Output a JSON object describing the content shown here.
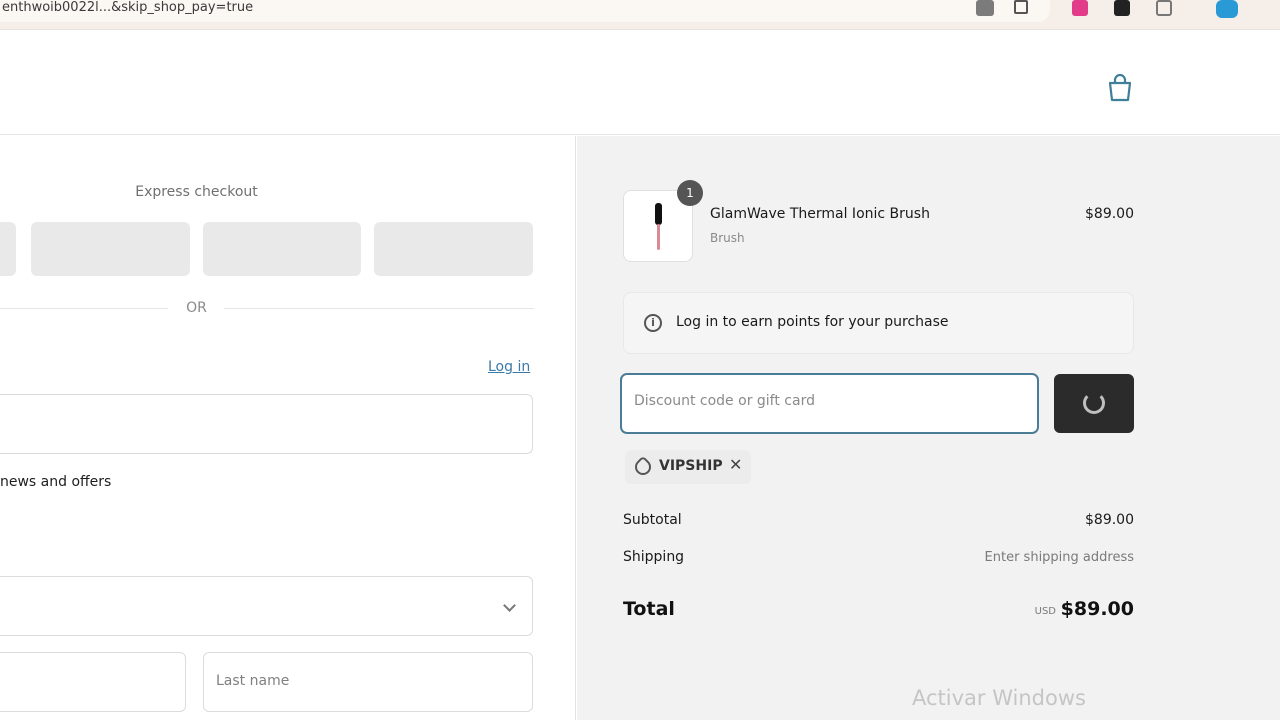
{
  "browser": {
    "url_text": "enthwoib0022l...&skip_shop_pay=true"
  },
  "express": {
    "title": "Express checkout",
    "or_label": "OR"
  },
  "contact": {
    "login_link": "Log in",
    "news_label": "news and offers"
  },
  "delivery": {
    "last_name_placeholder": "Last name"
  },
  "cart": {
    "item": {
      "name": "GlamWave Thermal Ionic Brush",
      "variant": "Brush",
      "price": "$89.00",
      "quantity": "1"
    },
    "earn_points_text": "Log in to earn points for your purchase",
    "discount_placeholder": "Discount code or gift card",
    "applied_code": "VIPSHIP",
    "subtotal_label": "Subtotal",
    "subtotal_value": "$89.00",
    "shipping_label": "Shipping",
    "shipping_value": "Enter shipping address",
    "total_label": "Total",
    "currency": "USD",
    "total_value": "$89.00"
  },
  "os_watermark": "Activar Windows",
  "colors": {
    "accent_link": "#3b7aa8",
    "focus_border": "#4a7d95",
    "apply_button": "#2b2b2b",
    "sidebar_bg": "#f2f2f2"
  }
}
